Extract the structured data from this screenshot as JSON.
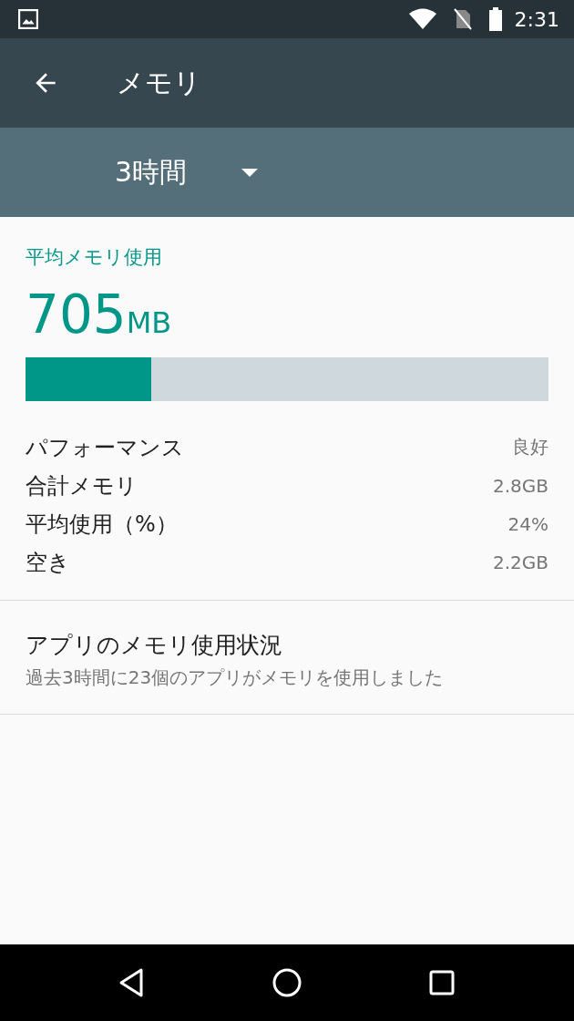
{
  "status_bar": {
    "time": "2:31"
  },
  "toolbar": {
    "title": "メモリ"
  },
  "spinner": {
    "value": "3時間"
  },
  "summary": {
    "label": "平均メモリ使用",
    "value": "705",
    "unit": "MB",
    "level": 0.24
  },
  "stats": [
    {
      "label": "パフォーマンス",
      "value": "良好"
    },
    {
      "label": "合計メモリ",
      "value": "2.8GB"
    },
    {
      "label": "平均使用（%）",
      "value": "24%"
    },
    {
      "label": "空き",
      "value": "2.2GB"
    }
  ],
  "app_usage": {
    "title": "アプリのメモリ使用状況",
    "subtitle": "過去3時間に23個のアプリがメモリを使用しました"
  }
}
